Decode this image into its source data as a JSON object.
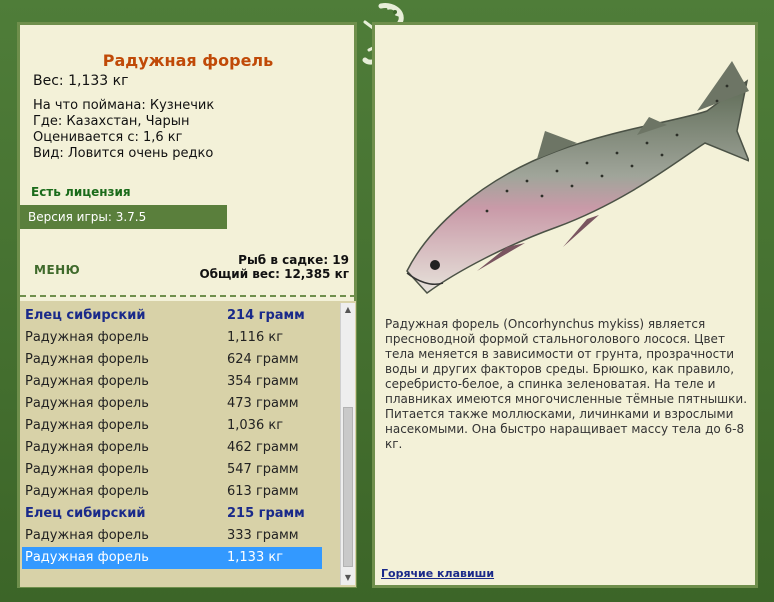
{
  "fish_card": {
    "title": "Радужная форель",
    "weight": "Вес: 1,133 кг",
    "caught_with": "На что поймана: Кузнечик",
    "where": "Где: Казахстан, Чарын",
    "valued_from": "Оценивается с: 1,6 кг",
    "kind": "Вид: Ловится очень редко"
  },
  "license": "Есть лицензия",
  "version": "Версия игры: 3.7.5",
  "menu_label": "МЕНЮ",
  "stats": {
    "fish_in_keepnet": "Рыб в садке: 19",
    "total_weight": "Общий вес: 12,385 кг"
  },
  "catch_list": [
    {
      "name": "Елец сибирский",
      "weight": "214 грамм",
      "special": true
    },
    {
      "name": "Радужная форель",
      "weight": "1,116 кг"
    },
    {
      "name": "Радужная форель",
      "weight": "624 грамм"
    },
    {
      "name": "Радужная форель",
      "weight": "354 грамм"
    },
    {
      "name": "Радужная форель",
      "weight": "473 грамм"
    },
    {
      "name": "Радужная форель",
      "weight": "1,036 кг"
    },
    {
      "name": "Радужная форель",
      "weight": "462 грамм"
    },
    {
      "name": "Радужная форель",
      "weight": "547 грамм"
    },
    {
      "name": "Радужная форель",
      "weight": "613 грамм"
    },
    {
      "name": "Елец сибирский",
      "weight": "215 грамм",
      "special": true
    },
    {
      "name": "Радужная форель",
      "weight": "333 грамм"
    },
    {
      "name": "Радужная форель",
      "weight": "1,133 кг",
      "selected": true
    }
  ],
  "description": "Радужная форель (Oncorhynchus mykiss) является пресноводной формой стальноголового лосося. Цвет тела меняется в зависимости от грунта, прозрачности воды и других факторов среды. Брюшко, как правило, серебристо-белое, а спинка зеленоватая. На теле и плавниках имеются многочисленные тёмные пятнышки. Питается также моллюсками, личинками и взрослыми насекомыми. Она быстро наращивает массу тела до 6-8 кг.",
  "hotkeys_link": "Горячие клавиши",
  "colors": {
    "frame": "#3f6a2b",
    "panel": "#f3f1d8",
    "title": "#c04a08",
    "selection": "#3399ff",
    "special_row": "#1a2a8a"
  }
}
